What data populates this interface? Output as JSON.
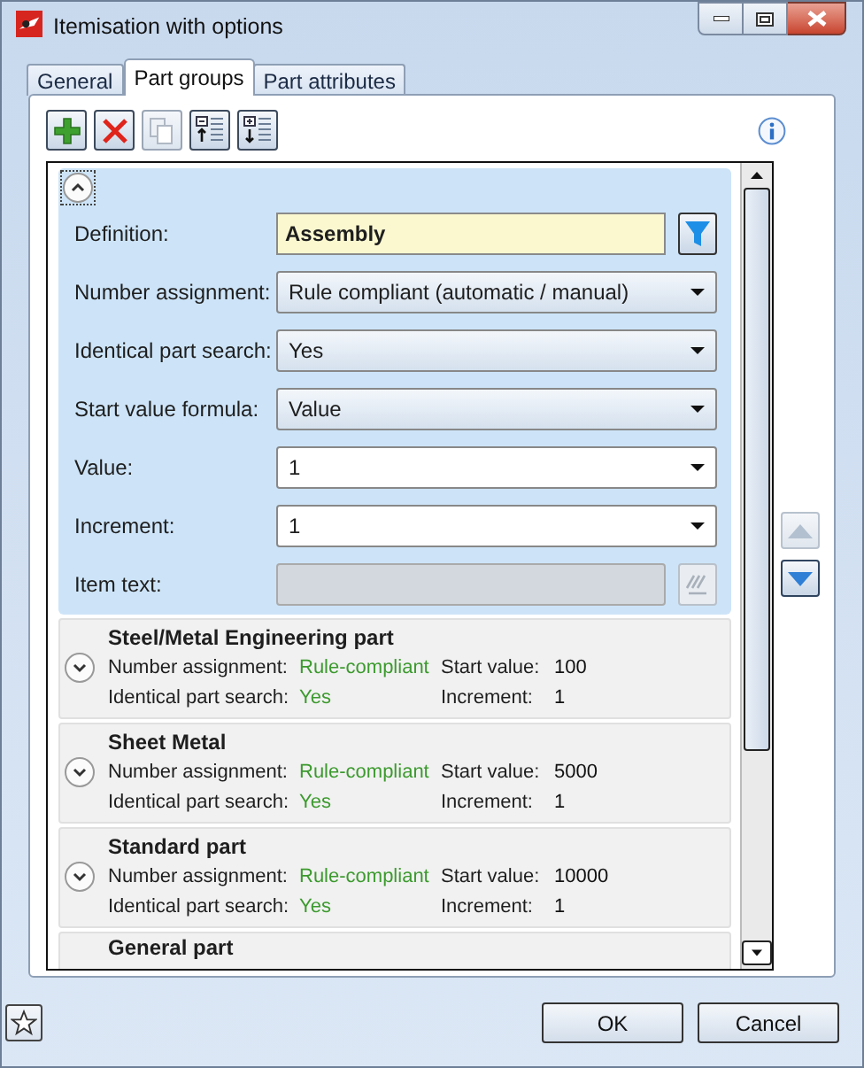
{
  "window": {
    "title": "Itemisation with options"
  },
  "tabs": [
    {
      "label": "General",
      "selected": false
    },
    {
      "label": "Part groups",
      "selected": true
    },
    {
      "label": "Part attributes",
      "selected": false
    }
  ],
  "groups": [
    {
      "expanded": true,
      "fields": [
        {
          "kind": "filter",
          "label": "Definition:",
          "value": "Assembly"
        },
        {
          "kind": "select",
          "label": "Number assignment:",
          "value": "Rule compliant (automatic / manual)"
        },
        {
          "kind": "select",
          "label": "Identical part search:",
          "value": "Yes"
        },
        {
          "kind": "select",
          "label": "Start value formula:",
          "value": "Value"
        },
        {
          "kind": "combo",
          "label": "Value:",
          "value": "1"
        },
        {
          "kind": "combo",
          "label": "Increment:",
          "value": "1"
        },
        {
          "kind": "readonly",
          "label": "Item text:"
        }
      ]
    },
    {
      "expanded": false,
      "title": "Steel/Metal Engineering part",
      "rows": [
        [
          {
            "label": "Number assignment:",
            "value": "Rule-compliant"
          },
          {
            "label": "Start value:",
            "value": "100"
          }
        ],
        [
          {
            "label": "Identical part search:",
            "value": "Yes"
          },
          {
            "label": "Increment:",
            "value": "1"
          }
        ]
      ]
    },
    {
      "expanded": false,
      "title": "Sheet Metal",
      "rows": [
        [
          {
            "label": "Number assignment:",
            "value": "Rule-compliant"
          },
          {
            "label": "Start value:",
            "value": "5000"
          }
        ],
        [
          {
            "label": "Identical part search:",
            "value": "Yes"
          },
          {
            "label": "Increment:",
            "value": "1"
          }
        ]
      ]
    },
    {
      "expanded": false,
      "title": "Standard part",
      "rows": [
        [
          {
            "label": "Number assignment:",
            "value": "Rule-compliant"
          },
          {
            "label": "Start value:",
            "value": "10000"
          }
        ],
        [
          {
            "label": "Identical part search:",
            "value": "Yes"
          },
          {
            "label": "Increment:",
            "value": "1"
          }
        ]
      ]
    },
    {
      "expanded": false,
      "title": "General part"
    }
  ],
  "buttons": [
    {
      "label": "OK"
    },
    {
      "label": "Cancel"
    }
  ]
}
